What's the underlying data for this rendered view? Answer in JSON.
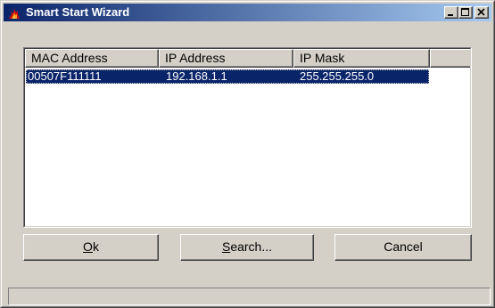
{
  "window": {
    "title": "Smart Start Wizard",
    "app_icon": "wizard-flame-icon",
    "caption_buttons": [
      "minimize-icon",
      "maximize-icon",
      "close-icon"
    ]
  },
  "list": {
    "columns": [
      "MAC Address",
      "IP Address",
      "IP Mask"
    ],
    "rows": [
      {
        "mac": "00507F111111",
        "ip": "192.168.1.1",
        "mask": "255.255.255.0",
        "selected": true
      }
    ]
  },
  "buttons": {
    "ok": {
      "mnemonic": "O",
      "rest": "k"
    },
    "search": {
      "mnemonic": "S",
      "rest": "earch..."
    },
    "cancel": "Cancel"
  },
  "status_text": "",
  "colors": {
    "title_start": "#0a246a",
    "title_end": "#a6caf0",
    "face": "#d4d0c8",
    "selection": "#0a246a"
  }
}
